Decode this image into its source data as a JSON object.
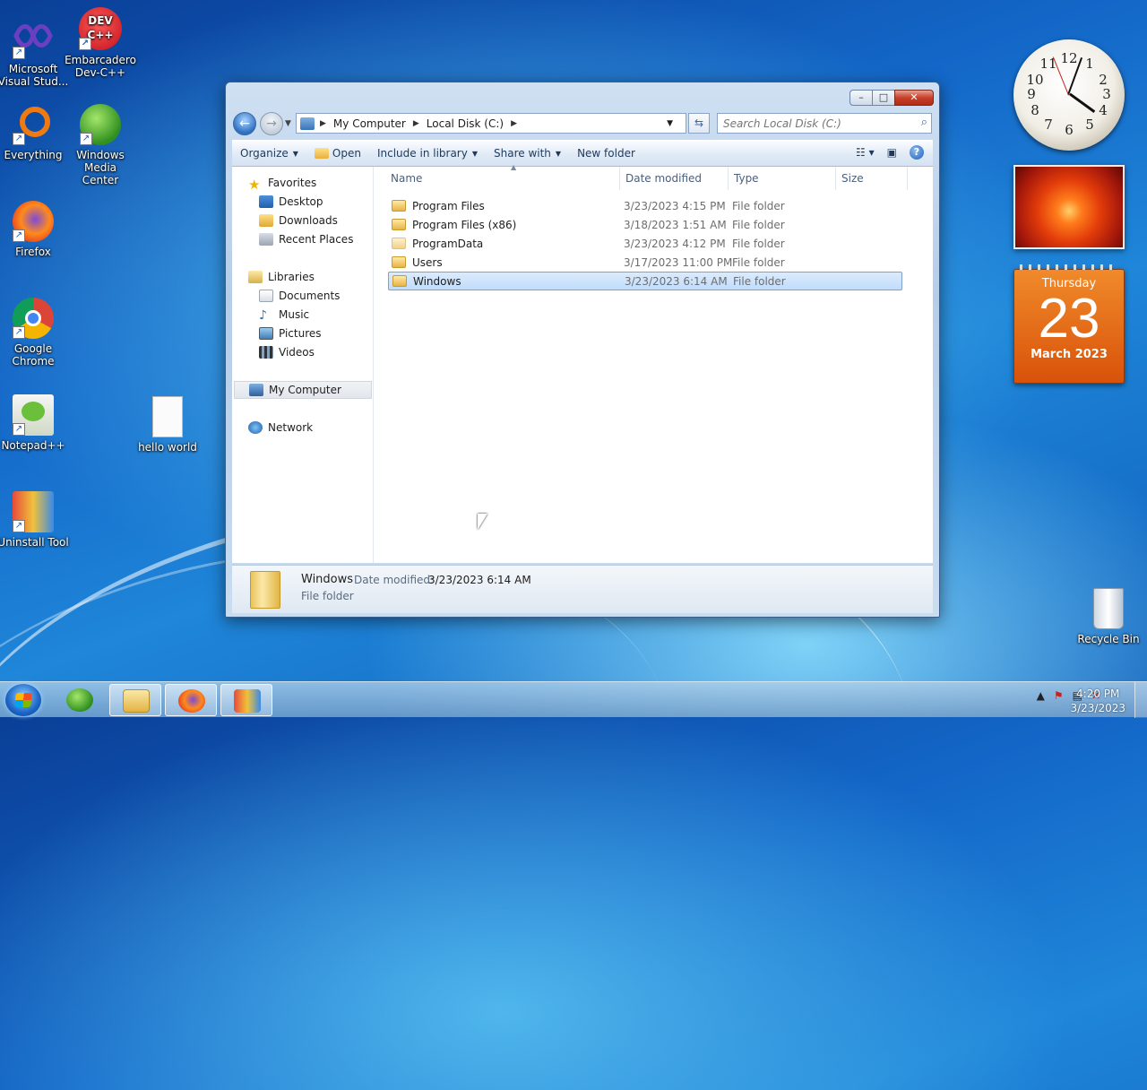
{
  "desktop": {
    "icons": [
      {
        "label": "Microsoft Visual Stud..."
      },
      {
        "label": "Embarcadero Dev-C++"
      },
      {
        "label": "Everything"
      },
      {
        "label": "Windows Media Center"
      },
      {
        "label": "Firefox"
      },
      {
        "label": "Google Chrome"
      },
      {
        "label": "Notepad++"
      },
      {
        "label": "hello world"
      },
      {
        "label": "Uninstall Tool"
      },
      {
        "label": "Recycle Bin"
      }
    ],
    "devcpp_badge": "DEV C++"
  },
  "gadgets": {
    "clock_numbers": [
      "12",
      "1",
      "2",
      "3",
      "4",
      "5",
      "6",
      "7",
      "8",
      "9",
      "10",
      "11"
    ],
    "calendar": {
      "day": "Thursday",
      "date": "23",
      "month": "March 2023"
    }
  },
  "window": {
    "controls": {
      "minimize": "–",
      "maximize": "□",
      "close": "✕"
    },
    "address": {
      "crumbs": [
        "My Computer",
        "Local Disk (C:)"
      ]
    },
    "search_placeholder": "Search Local Disk (C:)",
    "toolbar": {
      "organize": "Organize",
      "open": "Open",
      "include_in_library": "Include in library",
      "share_with": "Share with",
      "new_folder": "New folder"
    },
    "nav": {
      "favorites": "Favorites",
      "desktop": "Desktop",
      "downloads": "Downloads",
      "recent_places": "Recent Places",
      "libraries": "Libraries",
      "documents": "Documents",
      "music": "Music",
      "pictures": "Pictures",
      "videos": "Videos",
      "my_computer": "My Computer",
      "network": "Network"
    },
    "columns": {
      "name": "Name",
      "date_modified": "Date modified",
      "type": "Type",
      "size": "Size"
    },
    "files": [
      {
        "name": "Program Files",
        "date": "3/23/2023 4:15 PM",
        "type": "File folder"
      },
      {
        "name": "Program Files (x86)",
        "date": "3/18/2023 1:51 AM",
        "type": "File folder"
      },
      {
        "name": "ProgramData",
        "date": "3/23/2023 4:12 PM",
        "type": "File folder"
      },
      {
        "name": "Users",
        "date": "3/17/2023 11:00 PM",
        "type": "File folder"
      },
      {
        "name": "Windows",
        "date": "3/23/2023 6:14 AM",
        "type": "File folder"
      }
    ],
    "details": {
      "name": "Windows",
      "date_label": "Date modified:",
      "date_value": "3/23/2023 6:14 AM",
      "type": "File folder"
    }
  },
  "taskbar": {
    "time": "4:20 PM",
    "date": "3/23/2023",
    "tray_up_arrow": "▲"
  }
}
